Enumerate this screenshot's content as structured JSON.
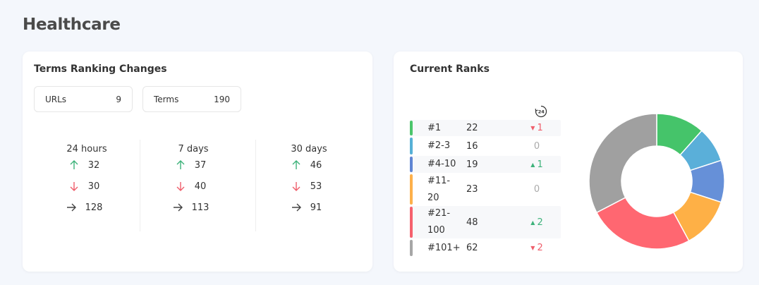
{
  "page": {
    "title": "Healthcare"
  },
  "ranking_changes": {
    "title": "Terms Ranking Changes",
    "urls": {
      "label": "URLs",
      "value": "9"
    },
    "terms": {
      "label": "Terms",
      "value": "190"
    },
    "periods": [
      {
        "label": "24 hours",
        "up": "32",
        "down": "30",
        "same": "128"
      },
      {
        "label": "7 days",
        "up": "37",
        "down": "40",
        "same": "113"
      },
      {
        "label": "30 days",
        "up": "46",
        "down": "53",
        "same": "91"
      }
    ]
  },
  "current_ranks": {
    "title": "Current Ranks",
    "clock_icon": "24-hour-clock-icon",
    "clock_label": "24",
    "rows": [
      {
        "label": "#1",
        "count": "22",
        "change": "1",
        "direction": "down",
        "color": "#4bc56b"
      },
      {
        "label": "#2-3",
        "count": "16",
        "change": "0",
        "direction": "none",
        "color": "#56b0d6"
      },
      {
        "label": "#4-10",
        "count": "19",
        "change": "1",
        "direction": "up",
        "color": "#5f85d3"
      },
      {
        "label": "#11-\n20",
        "count": "23",
        "change": "0",
        "direction": "none",
        "color": "#fdb04b"
      },
      {
        "label": "#21-\n100",
        "count": "48",
        "change": "2",
        "direction": "up",
        "color": "#f5616d"
      },
      {
        "label": "#101+",
        "count": "62",
        "change": "2",
        "direction": "down",
        "color": "#a6a6a6"
      }
    ]
  },
  "chart_data": {
    "type": "pie",
    "categories": [
      "#1",
      "#2-3",
      "#4-10",
      "#11-20",
      "#21-100",
      "#101+"
    ],
    "values": [
      22,
      16,
      19,
      23,
      48,
      62
    ],
    "colors": [
      "#45c46a",
      "#5aafd9",
      "#6690d8",
      "#feb046",
      "#ff6771",
      "#a0a0a0"
    ],
    "donut": true
  },
  "colors": {
    "up": "#3db27a",
    "down": "#ef5e6b",
    "neutral": "#555555"
  }
}
